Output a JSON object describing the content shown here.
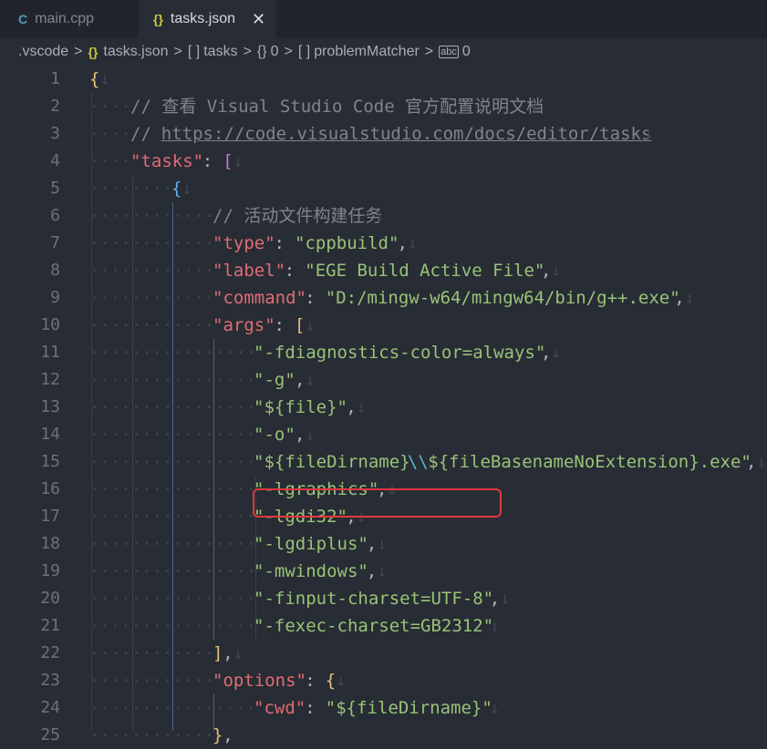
{
  "tabs": [
    {
      "icon": "C",
      "label": "main.cpp"
    },
    {
      "icon": "{}",
      "label": "tasks.json",
      "close": "✕"
    }
  ],
  "breadcrumb": {
    "items": [
      ".vscode",
      "tasks.json",
      "tasks",
      "0",
      "problemMatcher",
      "0"
    ],
    "symbols": [
      "{}",
      "[ ]",
      "{}",
      "[ ]",
      "abc"
    ],
    "separator": ">"
  },
  "editor": {
    "whitespace_glyph": "·",
    "eol_glyph": "↓",
    "lines": [
      {
        "n": "1",
        "segments": [
          {
            "t": "{",
            "c": "b1"
          },
          {
            "t": "↓",
            "c": "ws"
          }
        ]
      },
      {
        "n": "2",
        "segments": [
          {
            "t": "····",
            "c": "ws"
          },
          {
            "t": "// 查看 Visual Studio Code 官方配置说明文档",
            "c": "cm"
          },
          {
            "t": "↓",
            "c": "ws"
          }
        ]
      },
      {
        "n": "3",
        "segments": [
          {
            "t": "····",
            "c": "ws"
          },
          {
            "t": "// ",
            "c": "cm"
          },
          {
            "t": "https://code.visualstudio.com/docs/editor/tasks",
            "c": "lnk"
          },
          {
            "t": "↓",
            "c": "ws"
          }
        ]
      },
      {
        "n": "4",
        "segments": [
          {
            "t": "····",
            "c": "ws"
          },
          {
            "t": "\"tasks\"",
            "c": "key"
          },
          {
            "t": ": ",
            "c": ""
          },
          {
            "t": "[",
            "c": "b2"
          },
          {
            "t": "↓",
            "c": "ws"
          }
        ]
      },
      {
        "n": "5",
        "segments": [
          {
            "t": "········",
            "c": "ws"
          },
          {
            "t": "{",
            "c": "b3"
          },
          {
            "t": "↓",
            "c": "ws"
          }
        ]
      },
      {
        "n": "6",
        "segments": [
          {
            "t": "············",
            "c": "ws"
          },
          {
            "t": "// 活动文件构建任务",
            "c": "cm"
          },
          {
            "t": "↓",
            "c": "ws"
          }
        ]
      },
      {
        "n": "7",
        "segments": [
          {
            "t": "············",
            "c": "ws"
          },
          {
            "t": "\"type\"",
            "c": "key"
          },
          {
            "t": ": ",
            "c": ""
          },
          {
            "t": "\"cppbuild\"",
            "c": "str"
          },
          {
            "t": ",",
            "c": ""
          },
          {
            "t": "↓",
            "c": "ws"
          }
        ]
      },
      {
        "n": "8",
        "segments": [
          {
            "t": "············",
            "c": "ws"
          },
          {
            "t": "\"label\"",
            "c": "key"
          },
          {
            "t": ": ",
            "c": ""
          },
          {
            "t": "\"EGE Build Active File\"",
            "c": "str"
          },
          {
            "t": ",",
            "c": ""
          },
          {
            "t": "↓",
            "c": "ws"
          }
        ]
      },
      {
        "n": "9",
        "segments": [
          {
            "t": "············",
            "c": "ws"
          },
          {
            "t": "\"command\"",
            "c": "key"
          },
          {
            "t": ": ",
            "c": ""
          },
          {
            "t": "\"D:/mingw-w64/mingw64/bin/g++.exe\"",
            "c": "str"
          },
          {
            "t": ",",
            "c": ""
          },
          {
            "t": "↓",
            "c": "ws"
          }
        ]
      },
      {
        "n": "10",
        "segments": [
          {
            "t": "············",
            "c": "ws"
          },
          {
            "t": "\"args\"",
            "c": "key"
          },
          {
            "t": ": ",
            "c": ""
          },
          {
            "t": "[",
            "c": "b1"
          },
          {
            "t": "↓",
            "c": "ws"
          }
        ]
      },
      {
        "n": "11",
        "segments": [
          {
            "t": "················",
            "c": "ws"
          },
          {
            "t": "\"-fdiagnostics-color=always\"",
            "c": "str"
          },
          {
            "t": ",",
            "c": ""
          },
          {
            "t": "↓",
            "c": "ws"
          }
        ]
      },
      {
        "n": "12",
        "segments": [
          {
            "t": "················",
            "c": "ws"
          },
          {
            "t": "\"-g\"",
            "c": "str"
          },
          {
            "t": ",",
            "c": ""
          },
          {
            "t": "↓",
            "c": "ws"
          }
        ]
      },
      {
        "n": "13",
        "segments": [
          {
            "t": "················",
            "c": "ws"
          },
          {
            "t": "\"${file}\"",
            "c": "str"
          },
          {
            "t": ",",
            "c": ""
          },
          {
            "t": "↓",
            "c": "ws"
          }
        ]
      },
      {
        "n": "14",
        "segments": [
          {
            "t": "················",
            "c": "ws"
          },
          {
            "t": "\"-o\"",
            "c": "str"
          },
          {
            "t": ",",
            "c": ""
          },
          {
            "t": "↓",
            "c": "ws"
          }
        ]
      },
      {
        "n": "15",
        "segments": [
          {
            "t": "················",
            "c": "ws"
          },
          {
            "t": "\"${fileDirname}",
            "c": "str"
          },
          {
            "t": "\\\\",
            "c": "esc"
          },
          {
            "t": "${fileBasenameNoExtension}.exe\"",
            "c": "str"
          },
          {
            "t": ",",
            "c": ""
          },
          {
            "t": "↓",
            "c": "ws"
          }
        ]
      },
      {
        "n": "16",
        "segments": [
          {
            "t": "················",
            "c": "ws"
          },
          {
            "t": "\"-lgraphics\"",
            "c": "str"
          },
          {
            "t": ",",
            "c": ""
          },
          {
            "t": "↓",
            "c": "ws"
          }
        ]
      },
      {
        "n": "17",
        "segments": [
          {
            "t": "················",
            "c": "ws"
          },
          {
            "t": "\"-lgdi32\"",
            "c": "str"
          },
          {
            "t": ",",
            "c": ""
          },
          {
            "t": "↓",
            "c": "ws"
          }
        ]
      },
      {
        "n": "18",
        "segments": [
          {
            "t": "················",
            "c": "ws"
          },
          {
            "t": "\"-lgdiplus\"",
            "c": "str"
          },
          {
            "t": ",",
            "c": ""
          },
          {
            "t": "↓",
            "c": "ws"
          }
        ]
      },
      {
        "n": "19",
        "segments": [
          {
            "t": "················",
            "c": "ws"
          },
          {
            "t": "\"-mwindows\"",
            "c": "str"
          },
          {
            "t": ",",
            "c": ""
          },
          {
            "t": "↓",
            "c": "ws"
          }
        ]
      },
      {
        "n": "20",
        "segments": [
          {
            "t": "················",
            "c": "ws"
          },
          {
            "t": "\"-finput-charset=UTF-8\"",
            "c": "str"
          },
          {
            "t": ",",
            "c": ""
          },
          {
            "t": "↓",
            "c": "ws"
          }
        ]
      },
      {
        "n": "21",
        "segments": [
          {
            "t": "················",
            "c": "ws"
          },
          {
            "t": "\"-fexec-charset=GB2312\"",
            "c": "str"
          },
          {
            "t": "↓",
            "c": "ws"
          }
        ]
      },
      {
        "n": "22",
        "segments": [
          {
            "t": "············",
            "c": "ws"
          },
          {
            "t": "]",
            "c": "b1"
          },
          {
            "t": ",",
            "c": ""
          },
          {
            "t": "↓",
            "c": "ws"
          }
        ]
      },
      {
        "n": "23",
        "segments": [
          {
            "t": "············",
            "c": "ws"
          },
          {
            "t": "\"options\"",
            "c": "key"
          },
          {
            "t": ": ",
            "c": ""
          },
          {
            "t": "{",
            "c": "b1"
          },
          {
            "t": "↓",
            "c": "ws"
          }
        ]
      },
      {
        "n": "24",
        "segments": [
          {
            "t": "················",
            "c": "ws"
          },
          {
            "t": "\"cwd\"",
            "c": "key"
          },
          {
            "t": ": ",
            "c": ""
          },
          {
            "t": "\"${fileDirname}\"",
            "c": "str"
          },
          {
            "t": "↓",
            "c": "ws"
          }
        ]
      },
      {
        "n": "25",
        "segments": [
          {
            "t": "············",
            "c": "ws"
          },
          {
            "t": "}",
            "c": "b1"
          },
          {
            "t": ",",
            "c": ""
          }
        ]
      }
    ],
    "highlighted_line": "19"
  },
  "colors": {
    "editor_bg": "#282c34",
    "tab_bar_bg": "#21252b",
    "string": "#98c379",
    "key": "#e06c75",
    "comment": "#7f848e",
    "highlight_box": "#e0383c"
  }
}
